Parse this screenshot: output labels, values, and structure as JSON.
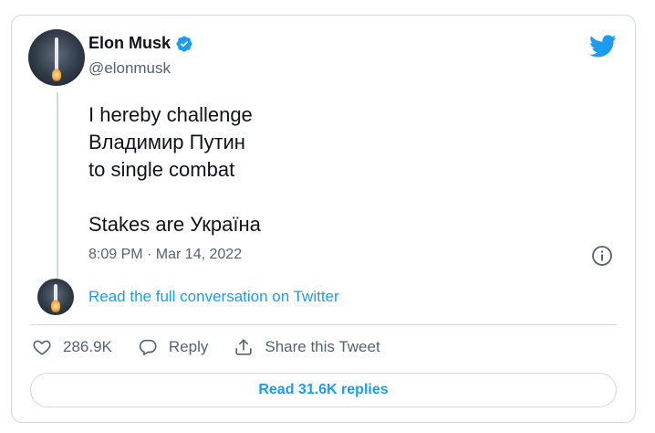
{
  "author": {
    "name": "Elon Musk",
    "handle": "@elonmusk",
    "verified": true
  },
  "tweet": {
    "text": "I hereby challenge\nВладимир Путин\nto single combat\n\nStakes are Україна",
    "timestamp": "8:09 PM · Mar 14, 2022"
  },
  "conversation_link": "Read the full conversation on Twitter",
  "actions": {
    "likes": "286.9K",
    "reply_label": "Reply",
    "share_label": "Share this Tweet"
  },
  "replies_button": "Read 31.6K replies",
  "icons": {
    "brand": "twitter-bird-icon",
    "info": "info-icon",
    "like": "heart-icon",
    "reply": "reply-bubble-icon",
    "share": "share-upload-icon",
    "verified": "verified-badge-icon"
  },
  "colors": {
    "accent": "#1d9bf0",
    "text": "#0f1419",
    "muted": "#536471",
    "border": "#cfd9de"
  }
}
